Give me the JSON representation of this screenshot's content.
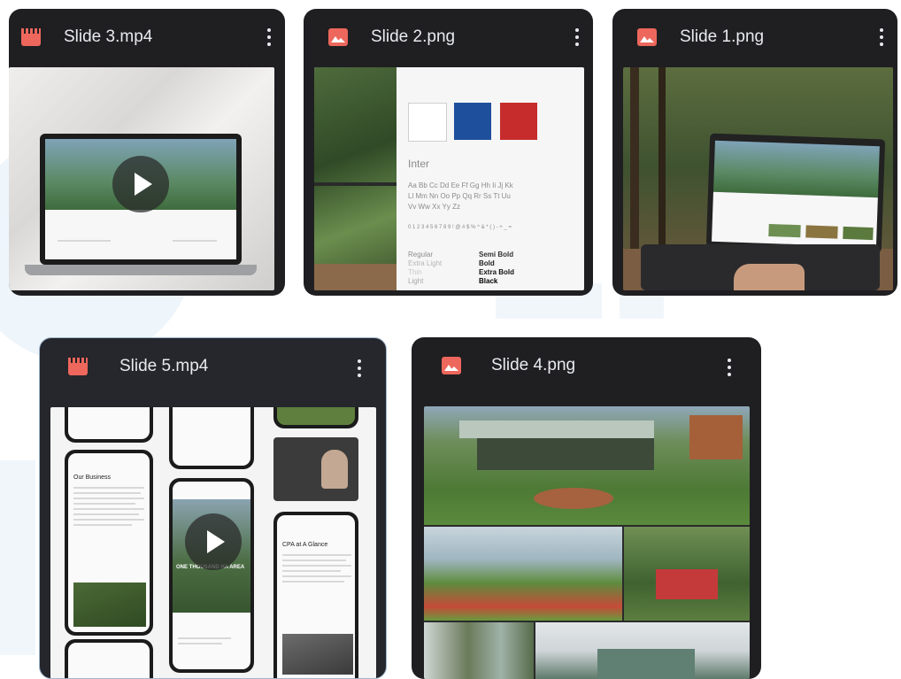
{
  "files": [
    {
      "name": "Slide 3.mp4",
      "type": "video",
      "icon": "video-file-icon",
      "selected": false
    },
    {
      "name": "Slide 2.png",
      "type": "image",
      "icon": "image-file-icon",
      "selected": false
    },
    {
      "name": "Slide 1.png",
      "type": "image",
      "icon": "image-file-icon",
      "selected": false
    },
    {
      "name": "Slide 5.mp4",
      "type": "video",
      "icon": "video-file-icon",
      "selected": true
    },
    {
      "name": "Slide 4.png",
      "type": "image",
      "icon": "image-file-icon",
      "selected": false
    }
  ],
  "style_guide": {
    "font_name": "Inter",
    "alphabet": [
      "Aa Bb Cc Dd Ee Ff Gg Hh Ii Jj Kk",
      "Ll Mm Nn Oo Pp Qq Rr Ss Tt Uu",
      "Vv Ww Xx Yy Zz"
    ],
    "digits": "0 1 2 3 4 5 6 7 8 9 ! @ # $ % ^ & * ( ) - + _ =",
    "weights_left": [
      "Regular",
      "Extra Light",
      "Thin",
      "Light"
    ],
    "weights_right": [
      "Semi Bold",
      "Bold",
      "Extra Bold",
      "Black"
    ],
    "swatch_colors": [
      "#ffffff",
      "#1e4f9c",
      "#c62c2c"
    ]
  },
  "phone_text": {
    "heading_a": "Our Business",
    "heading_b": "CPA at A Glance",
    "hero_caption": "ONE THOUSAND HA AREA"
  },
  "colors": {
    "card_bg": "#1f1f22",
    "accent_icon": "#ee675c",
    "text": "#e8eaed",
    "selected_border": "#9fb6cf"
  }
}
